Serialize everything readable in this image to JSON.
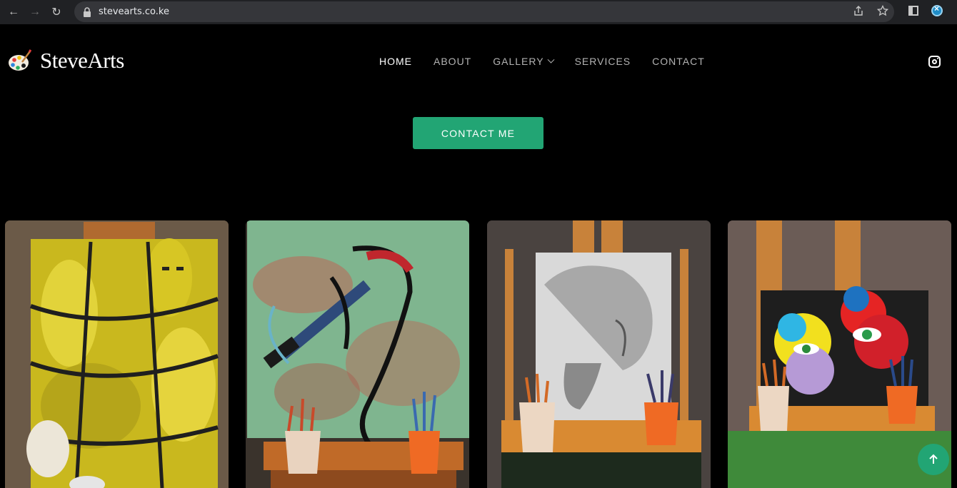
{
  "browser": {
    "url": "stevearts.co.ke",
    "icons": [
      "back-icon",
      "forward-icon",
      "reload-icon",
      "lock-icon",
      "share-icon",
      "star-icon",
      "side-panel-icon",
      "extension-icon"
    ]
  },
  "header": {
    "brand": "SteveArts",
    "nav": [
      {
        "label": "HOME",
        "active": true
      },
      {
        "label": "ABOUT",
        "active": false
      },
      {
        "label": "GALLERY",
        "active": false,
        "dropdown": true
      },
      {
        "label": "SERVICES",
        "active": false
      },
      {
        "label": "CONTACT",
        "active": false
      }
    ],
    "social_icon": "instagram-icon"
  },
  "hero": {
    "cta_label": "CONTACT ME"
  },
  "gallery": {
    "items": [
      {
        "name": "yellow-tribal-masks-painting"
      },
      {
        "name": "abstract-musician-painting"
      },
      {
        "name": "elephant-painting"
      },
      {
        "name": "colorful-eyes-painting"
      }
    ]
  },
  "colors": {
    "accent": "#22a574",
    "background": "#000000"
  }
}
